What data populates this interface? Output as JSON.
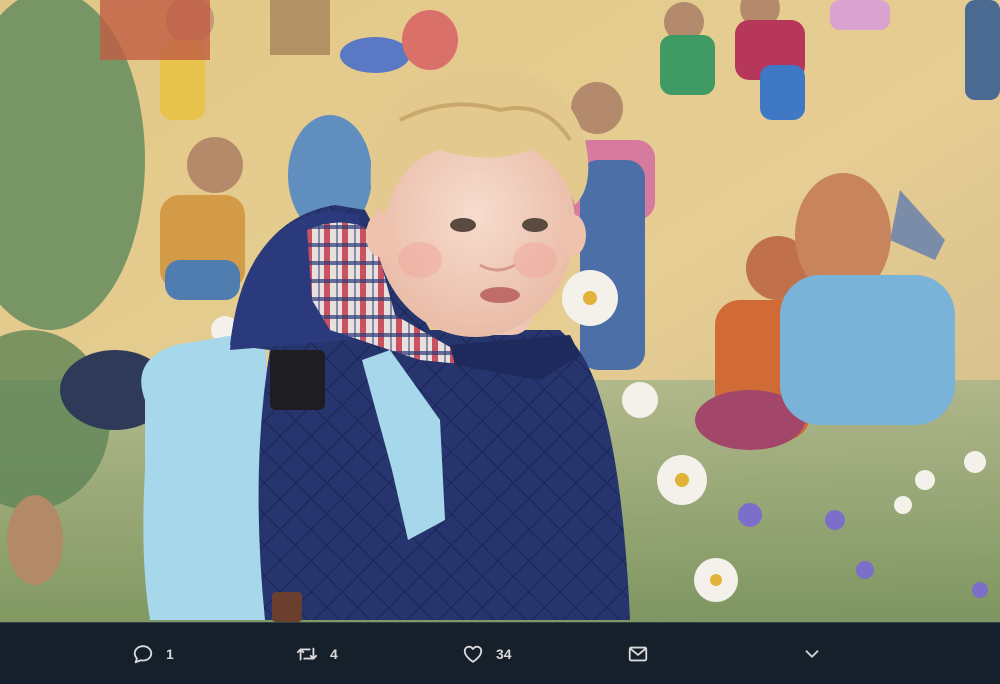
{
  "photo": {
    "subject": "child-in-quilted-jacket-with-backpack-before-mural"
  },
  "actions": {
    "reply": {
      "icon": "reply-icon",
      "count": "1"
    },
    "retweet": {
      "icon": "retweet-icon",
      "count": "4"
    },
    "like": {
      "icon": "heart-icon",
      "count": "34"
    },
    "dm": {
      "icon": "envelope-icon"
    },
    "more": {
      "icon": "chevron-down-icon"
    }
  },
  "colors": {
    "bar_background": "#15202b",
    "icon_color": "#d9d9d9"
  }
}
